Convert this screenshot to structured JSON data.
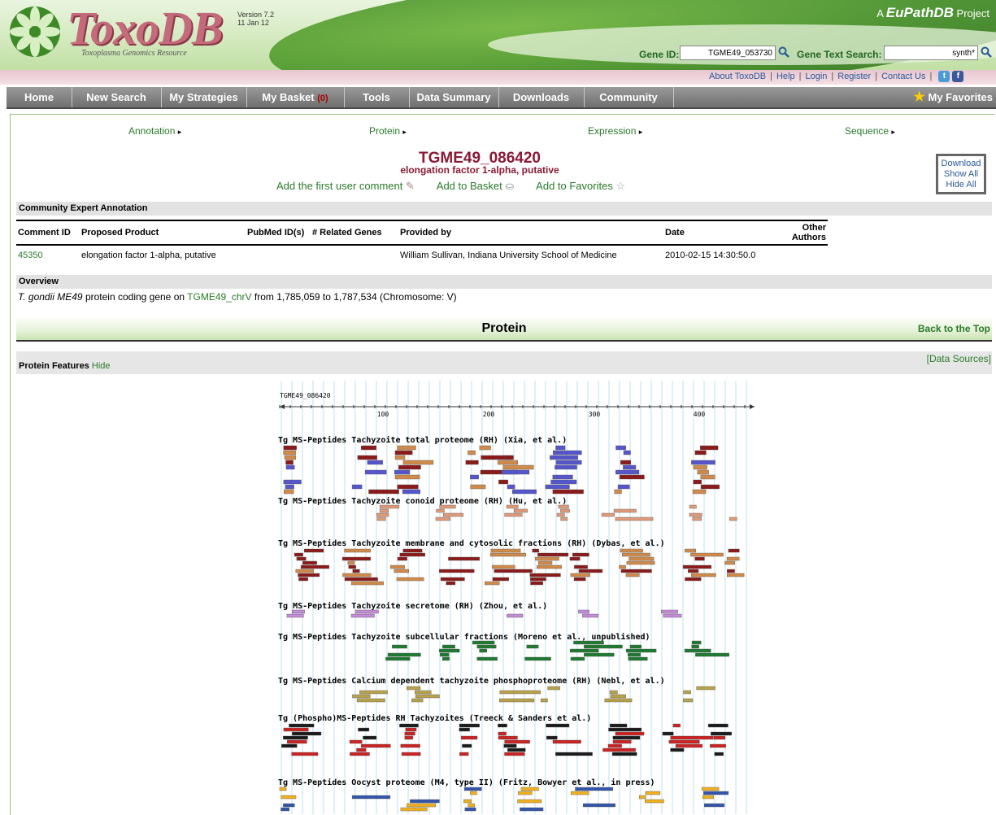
{
  "header": {
    "logo_text": "ToxoDB",
    "logo_subtitle": "Toxoplasma Genomics Resource",
    "version_line1": "Version 7.2",
    "version_line2": "11 Jan 12",
    "project_prefix": "A ",
    "project_name": "EuPathDB",
    "project_suffix": " Project",
    "gene_id_label": "Gene ID:",
    "gene_id_value": "TGME49_053730",
    "gene_text_label": "Gene Text Search:",
    "gene_text_value": "synth*",
    "links": [
      "About ToxoDB",
      "Help",
      "Login",
      "Register",
      "Contact Us"
    ]
  },
  "nav": {
    "items": [
      "Home",
      "New Search",
      "My Strategies",
      "My Basket",
      "Tools",
      "Data Summary",
      "Downloads",
      "Community"
    ],
    "basket_count": "(0)",
    "favorites": "My Favorites"
  },
  "sections": [
    "Annotation",
    "Protein",
    "Expression",
    "Sequence"
  ],
  "gene": {
    "id": "TGME49_086420",
    "product": "elongation factor 1-alpha, putative",
    "add_comment": "Add the first user comment",
    "add_basket": "Add to Basket",
    "add_favorites": "Add to Favorites",
    "download": "Download",
    "show_all": "Show All",
    "hide_all": "Hide All"
  },
  "community": {
    "heading": "Community Expert Annotation",
    "columns": [
      "Comment ID",
      "Proposed Product",
      "PubMed ID(s)",
      "# Related Genes",
      "Provided by",
      "Date",
      "Other Authors"
    ],
    "rows": [
      [
        "45350",
        "elongation factor 1-alpha, putative",
        "",
        "",
        "William Sullivan, Indiana University School of Medicine",
        "2010-02-15 14:30:50.0",
        ""
      ]
    ]
  },
  "overview": {
    "heading": "Overview",
    "species": "T. gondii ME49",
    "text1": " protein coding gene on ",
    "chrom_link": "TGME49_chrV",
    "text2": " from 1,785,059 to 1,787,534 (Chromosome: V)"
  },
  "protein": {
    "title": "Protein",
    "back_to_top": "Back to the Top",
    "data_sources": "[Data Sources]",
    "features_label": "Protein Features",
    "hide": "Hide",
    "track_name": "TGME49_086420",
    "ticks": [
      "100",
      "200",
      "300",
      "400"
    ],
    "track_titles": [
      "Tg MS-Peptides Tachyzoite total proteome (RH) (Xia, et al.)",
      "Tg MS-Peptides Tachyzoite conoid proteome (RH) (Hu, et al.)",
      "Tg MS-Peptides Tachyzoite membrane and cytosolic fractions (RH) (Dybas, et al.)",
      "Tg MS-Peptides Tachyzoite secretome (RH) (Zhou, et al.)",
      "Tg MS-Peptides Tachyzoite subcellular fractions (Moreno et al., unpublished)",
      "Tg MS-Peptides Calcium dependent tachyzoite phosphoproteome (RH) (Nebl, et al.)",
      "Tg (Phospho)MS-Peptides RH Tachyzoites (Treeck & Sanders et al.)",
      "Tg MS-Peptides Oocyst proteome (M4, type II) (Fritz, Bowyer et al., in press)"
    ]
  },
  "colors": {
    "track_xia": [
      "#8b1a1a",
      "#5555cc",
      "#d08a4a"
    ],
    "track_hu": [
      "#e09a7a"
    ],
    "track_dybas": [
      "#8b1a1a",
      "#d08a4a"
    ],
    "track_zhou": [
      "#c58ad8"
    ],
    "track_moreno": [
      "#1e7a30"
    ],
    "track_nebl": [
      "#b8a24a"
    ],
    "track_treeck": [
      "#1a1a1a",
      "#cc2222"
    ],
    "track_fritz": [
      "#f0b020",
      "#3355aa"
    ]
  }
}
